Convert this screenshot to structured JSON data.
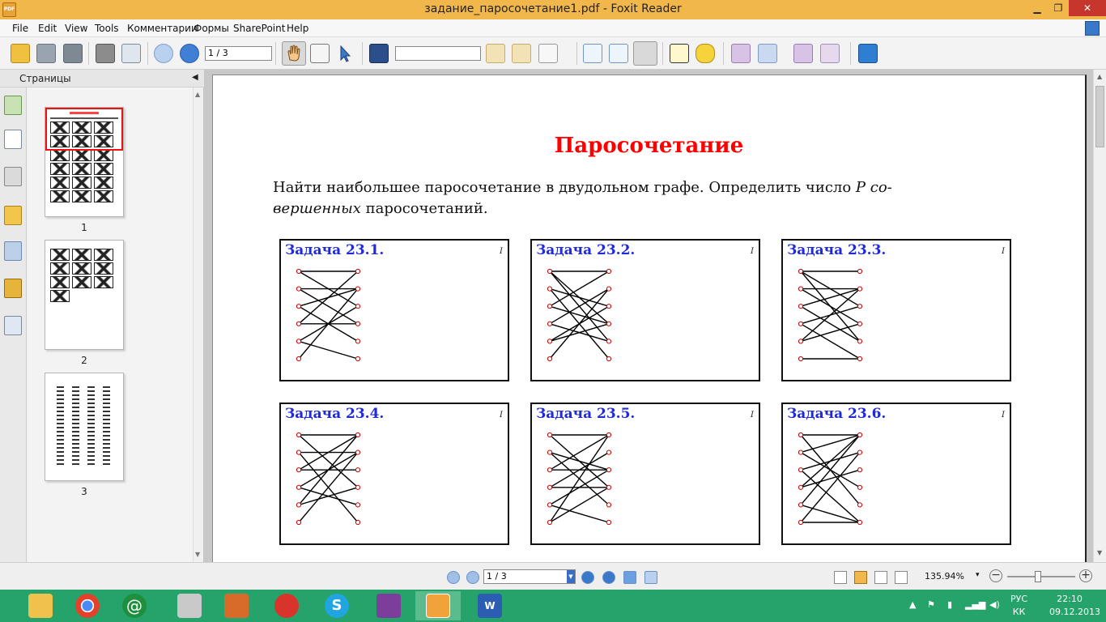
{
  "window": {
    "title": "задание_паросочетание1.pdf - Foxit Reader",
    "minimize": "▁",
    "maximize": "❐",
    "close": "✕"
  },
  "menu": [
    "File",
    "Edit",
    "View",
    "Tools",
    "Комментарии",
    "Формы",
    "SharePoint",
    "Help"
  ],
  "toolbar": {
    "page_value": "1 / 3",
    "find_value": "",
    "icons": [
      "open-icon",
      "save-icon",
      "save-all-icon",
      "print-icon",
      "fax-icon",
      "prev-page-icon",
      "next-page-icon",
      "hand-tool-icon",
      "select-text-icon",
      "select-icon",
      "find-icon",
      "find-prev-icon",
      "find-next-icon",
      "find-options-icon",
      "actual-size-icon",
      "fit-page-icon",
      "fit-width-icon",
      "typewriter-icon",
      "note-icon",
      "pdf-create-icon",
      "pdf-convert-icon",
      "pdf-combine-icon",
      "pdf-scan-icon",
      "share-icon"
    ]
  },
  "sidebar": {
    "title": "Страницы",
    "thumbnails": [
      {
        "label": "1"
      },
      {
        "label": "2"
      },
      {
        "label": "3"
      }
    ]
  },
  "document": {
    "title": "Паросочетание",
    "text_line1_a": "Найти наибольшее паросочетание в двудольном графе. Определить число ",
    "text_line1_b": "P со-",
    "text_line2_a": "вершенных",
    "text_line2_b": " паросочетаний.",
    "tasks": [
      {
        "title": "Задача 23.1.",
        "mark": "I",
        "edges": [
          [
            0,
            0
          ],
          [
            0,
            2
          ],
          [
            1,
            1
          ],
          [
            1,
            3
          ],
          [
            2,
            1
          ],
          [
            2,
            4
          ],
          [
            3,
            0
          ],
          [
            3,
            3
          ],
          [
            4,
            2
          ],
          [
            4,
            5
          ],
          [
            5,
            1
          ]
        ]
      },
      {
        "title": "Задача 23.2.",
        "mark": "I",
        "edges": [
          [
            0,
            0
          ],
          [
            0,
            3
          ],
          [
            0,
            4
          ],
          [
            1,
            2
          ],
          [
            1,
            5
          ],
          [
            2,
            0
          ],
          [
            2,
            3
          ],
          [
            3,
            1
          ],
          [
            3,
            4
          ],
          [
            4,
            2
          ],
          [
            4,
            3
          ],
          [
            5,
            1
          ]
        ]
      },
      {
        "title": "Задача 23.3.",
        "mark": "I",
        "edges": [
          [
            0,
            0
          ],
          [
            0,
            2
          ],
          [
            0,
            4
          ],
          [
            1,
            1
          ],
          [
            1,
            3
          ],
          [
            2,
            1
          ],
          [
            2,
            4
          ],
          [
            3,
            2
          ],
          [
            3,
            5
          ],
          [
            4,
            1
          ],
          [
            4,
            3
          ],
          [
            5,
            5
          ]
        ]
      },
      {
        "title": "Задача 23.4.",
        "mark": "I",
        "edges": [
          [
            0,
            0
          ],
          [
            0,
            3
          ],
          [
            1,
            1
          ],
          [
            1,
            5
          ],
          [
            2,
            0
          ],
          [
            2,
            2
          ],
          [
            3,
            1
          ],
          [
            3,
            4
          ],
          [
            4,
            0
          ],
          [
            4,
            3
          ],
          [
            5,
            1
          ]
        ]
      },
      {
        "title": "Задача 23.5.",
        "mark": "I",
        "edges": [
          [
            0,
            0
          ],
          [
            0,
            3
          ],
          [
            1,
            2
          ],
          [
            1,
            4
          ],
          [
            2,
            0
          ],
          [
            2,
            2
          ],
          [
            3,
            1
          ],
          [
            3,
            3
          ],
          [
            4,
            2
          ],
          [
            4,
            5
          ],
          [
            5,
            0
          ],
          [
            5,
            3
          ]
        ]
      },
      {
        "title": "Задача 23.6.",
        "mark": "I",
        "edges": [
          [
            0,
            0
          ],
          [
            0,
            4
          ],
          [
            1,
            0
          ],
          [
            1,
            3
          ],
          [
            2,
            1
          ],
          [
            2,
            5
          ],
          [
            3,
            0
          ],
          [
            3,
            2
          ],
          [
            4,
            0
          ],
          [
            4,
            5
          ],
          [
            5,
            1
          ],
          [
            5,
            5
          ]
        ]
      }
    ]
  },
  "statusbar": {
    "page_value": "1 / 3",
    "zoom": "135.94%",
    "zoom_dropdown": "▾",
    "zoom_minus": "−",
    "zoom_plus": "+",
    "zoom_level": 0.45
  },
  "taskbar": {
    "apps": [
      "file-explorer-icon",
      "chrome-icon",
      "mail-agent-icon",
      "tools-icon",
      "powerpoint-icon",
      "app-icon",
      "skype-icon",
      "winrar-icon",
      "foxit-icon",
      "word-icon"
    ],
    "tray_icons": [
      "arrow-up-icon",
      "flag-icon",
      "network-icon",
      "signal-icon",
      "volume-icon"
    ],
    "lang": "РУС",
    "lang_sub": "КК",
    "time": "22:10",
    "date": "09.12.2013"
  }
}
